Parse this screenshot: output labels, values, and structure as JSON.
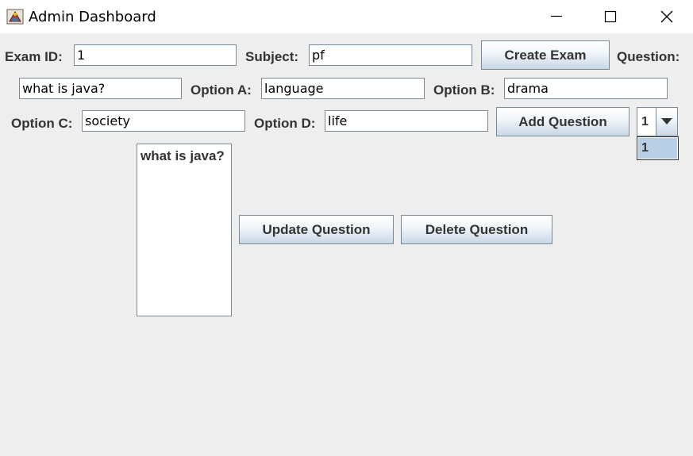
{
  "window": {
    "title": "Admin Dashboard"
  },
  "form": {
    "exam_id_label": "Exam ID:",
    "exam_id_value": "1",
    "subject_label": "Subject:",
    "subject_value": "pf",
    "create_exam_label": "Create Exam",
    "question_label": "Question:",
    "question_value": "what is java?",
    "option_a_label": "Option A:",
    "option_a_value": "language",
    "option_b_label": "Option B:",
    "option_b_value": "drama",
    "option_c_label": "Option C:",
    "option_c_value": "society",
    "option_d_label": "Option D:",
    "option_d_value": "life",
    "add_question_label": "Add Question"
  },
  "question_selector": {
    "selected": "1",
    "options": [
      "1"
    ]
  },
  "question_list": {
    "items": [
      "what is java?"
    ]
  },
  "actions": {
    "update_question_label": "Update Question",
    "delete_question_label": "Delete Question"
  },
  "colors": {
    "background": "#eeeeee",
    "titlebar": "#ffffff",
    "border": "#7a8a99",
    "selection": "#b8cfe5",
    "label_text": "#333333"
  },
  "icons": {
    "app": "java-app-icon",
    "minimize": "minimize-icon",
    "maximize": "maximize-icon",
    "close": "close-icon",
    "dropdown": "triangle-down-icon"
  }
}
